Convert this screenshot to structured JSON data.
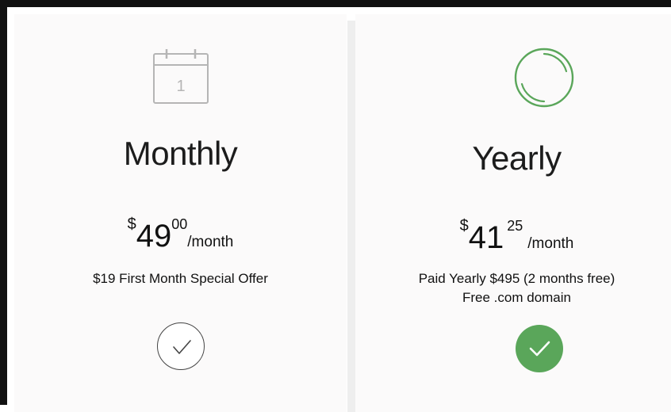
{
  "plans": {
    "monthly": {
      "title": "Monthly",
      "icon": "calendar-icon",
      "icon_text": "1",
      "currency": "$",
      "price_whole": "49",
      "price_cents": "00",
      "per": "/month",
      "note": "$19 First Month Special Offer",
      "selected": false
    },
    "yearly": {
      "title": "Yearly",
      "icon": "ring-icon",
      "currency": "$",
      "price_whole": "41",
      "price_cents": "25",
      "per": "/month",
      "note_line1": "Paid Yearly $495 (2 months free)",
      "note_line2": "Free .com domain",
      "selected": true
    }
  },
  "colors": {
    "accent_green": "#5aa65a",
    "icon_gray": "#b5b5b5",
    "text": "#1c1c1c"
  }
}
